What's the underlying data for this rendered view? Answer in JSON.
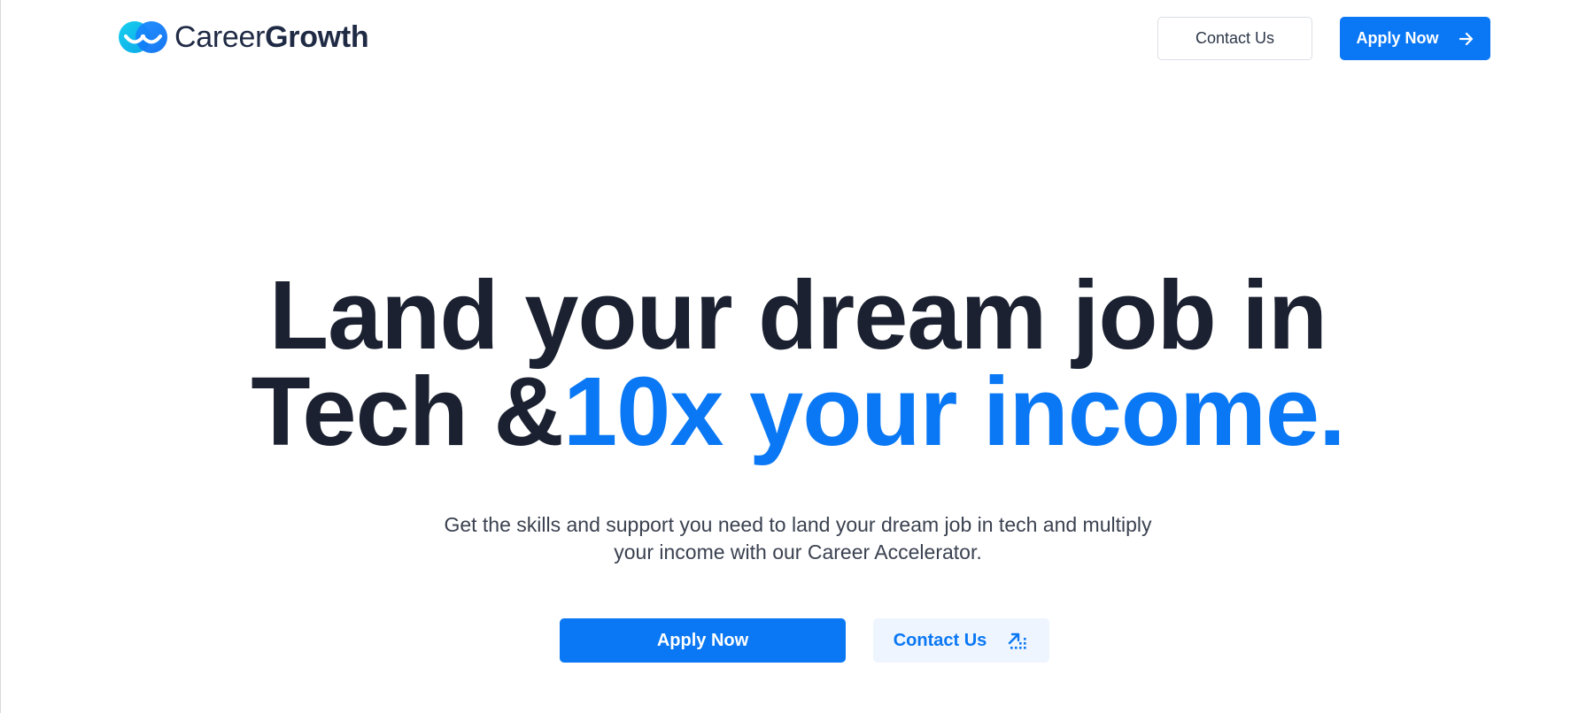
{
  "brand": {
    "name_light": "Career",
    "name_bold": "Growth",
    "colors": {
      "primary": "#0a78f4",
      "logo_cyan": "#13c2e8",
      "text_dark": "#1b2130"
    }
  },
  "header": {
    "contact_label": "Contact Us",
    "apply_label": "Apply Now",
    "apply_icon": "arrow-right-icon"
  },
  "hero": {
    "title_line1": "Land your dream job in",
    "title_line2_dark": "Tech &",
    "title_line2_accent": "10x your income.",
    "subtitle_line1": "Get the skills and support you need to land your dream job in tech and multiply",
    "subtitle_line2": "your income with our Career Accelerator.",
    "primary_cta": "Apply Now",
    "secondary_cta": "Contact Us",
    "secondary_icon": "growth-arrow-icon"
  }
}
